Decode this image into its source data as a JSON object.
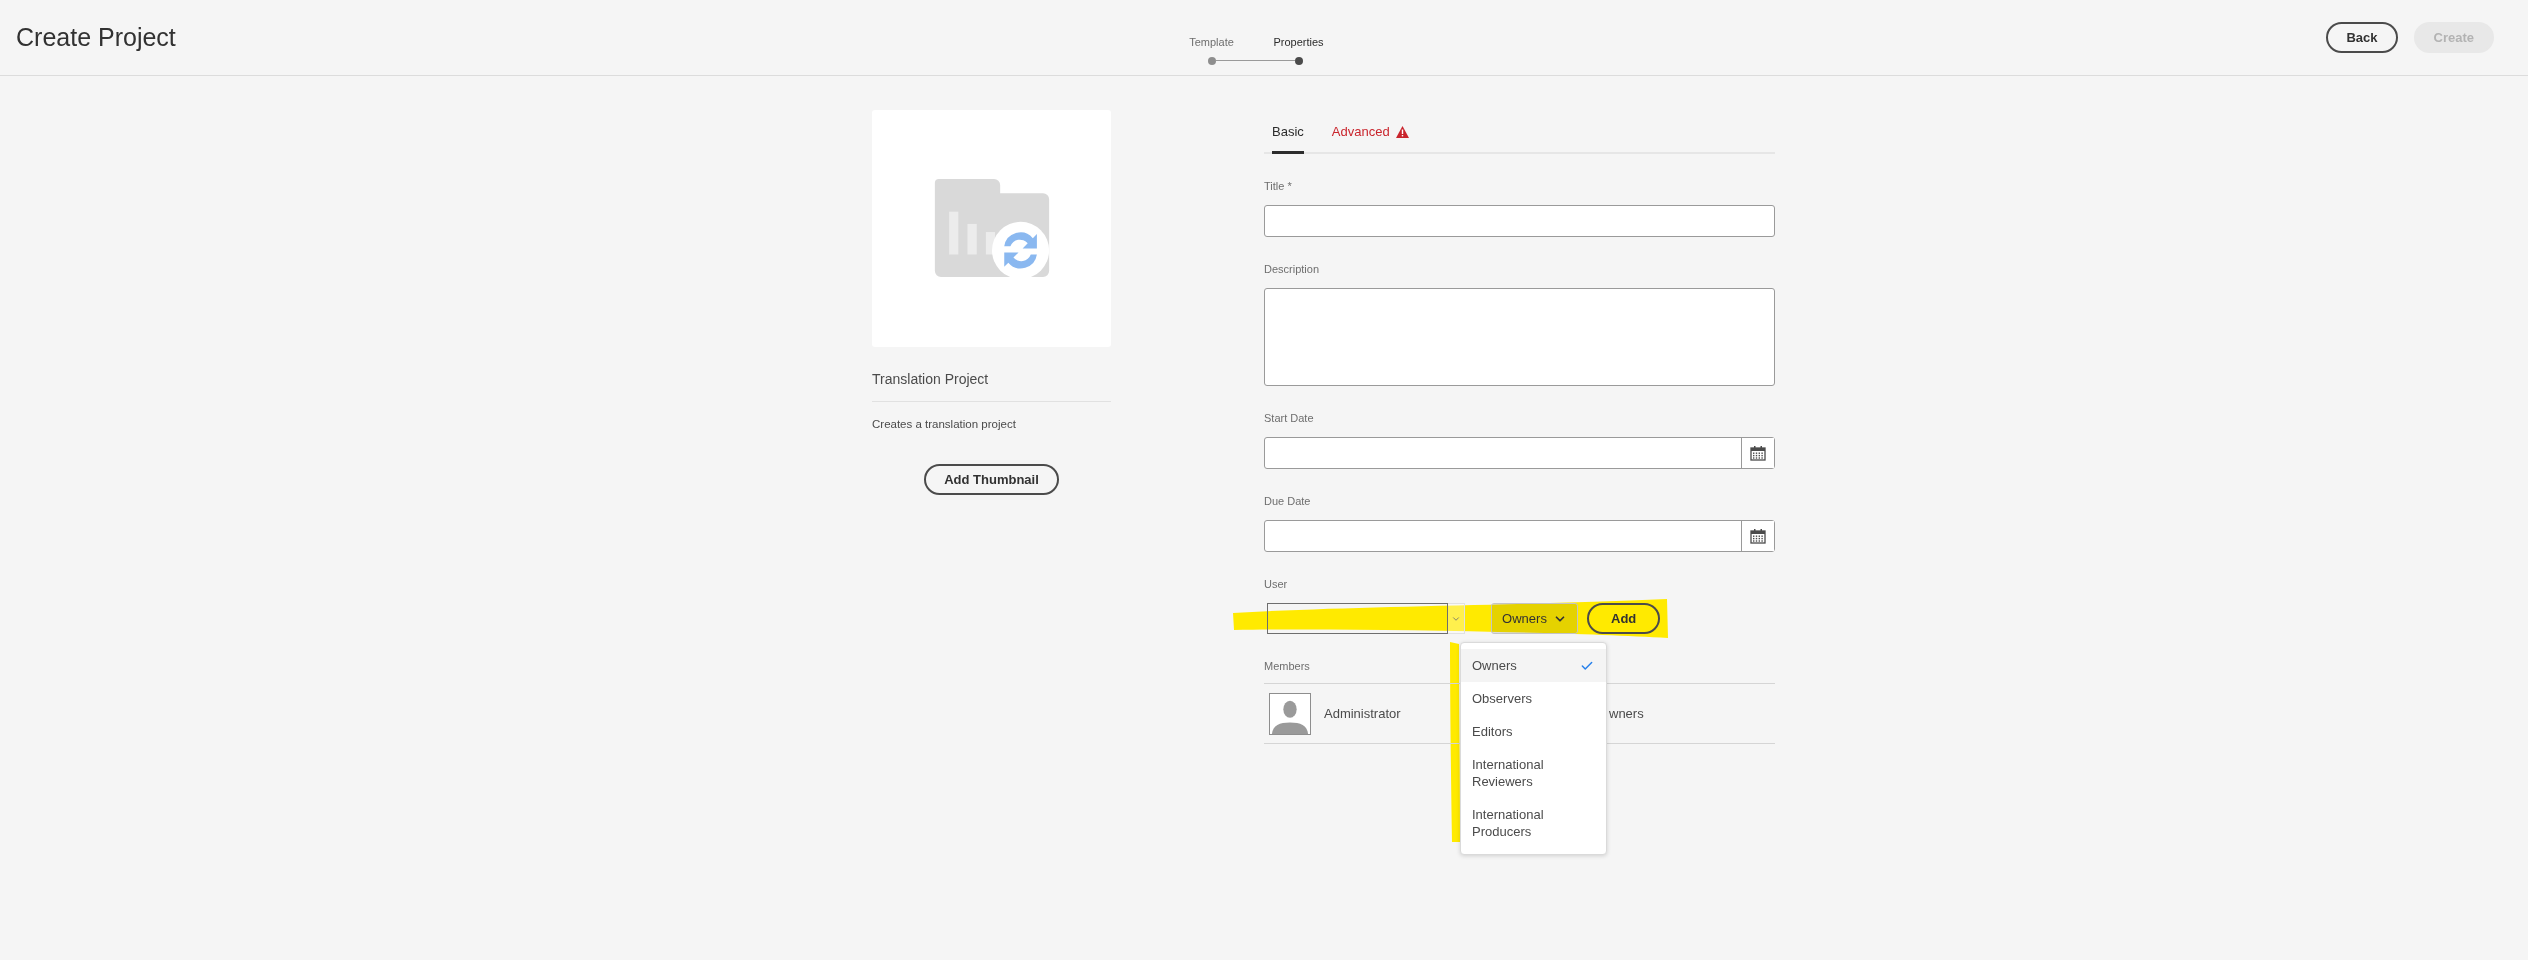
{
  "header": {
    "title": "Create Project",
    "steps": [
      {
        "label": "Template",
        "selected": false
      },
      {
        "label": "Properties",
        "selected": true
      }
    ],
    "buttons": [
      {
        "label": "Back",
        "disabled": false
      },
      {
        "label": "Create",
        "disabled": true
      }
    ]
  },
  "template": {
    "name": "Translation Project",
    "description": "Creates a translation project",
    "button": "Add Thumbnail"
  },
  "tabs": [
    {
      "label": "Basic",
      "selected": true,
      "warning": false
    },
    {
      "label": "Advanced",
      "selected": false,
      "warning": true
    }
  ],
  "fields": [
    {
      "label": "Title *",
      "kind": "text"
    },
    {
      "label": "Description",
      "kind": "textarea"
    },
    {
      "label": "Start Date",
      "kind": "date"
    },
    {
      "label": "Due Date",
      "kind": "date"
    }
  ],
  "user": {
    "label": "User",
    "role": "Owners",
    "add": "Add",
    "role_menu": {
      "open": true,
      "options": [
        {
          "label": "Owners",
          "selected": true
        },
        {
          "label": "Observers",
          "selected": false
        },
        {
          "label": "Editors",
          "selected": false
        },
        {
          "label": "International Reviewers",
          "selected": false
        },
        {
          "label": "International Producers",
          "selected": false
        }
      ]
    }
  },
  "members": {
    "label": "Members",
    "rows": [
      {
        "name": "Administrator",
        "role": "wners"
      }
    ]
  }
}
